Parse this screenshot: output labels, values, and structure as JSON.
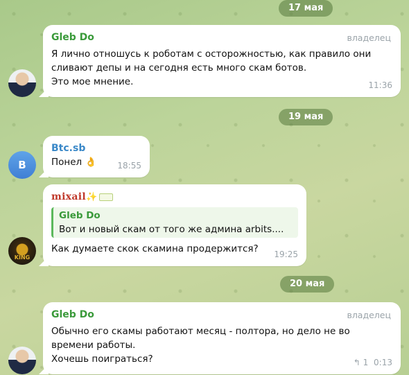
{
  "dates": [
    "17 мая",
    "19 мая",
    "20 мая"
  ],
  "messages": [
    {
      "sender": "Gleb Do",
      "role": "владелец",
      "text": "Я лично отношусь к роботам с осторожностью, как правило они\nсливают депы и на сегодня есть много скам ботов.\nЭто мое мнение.",
      "time": "11:36"
    },
    {
      "sender": "Btc.sb",
      "avatar_letter": "B",
      "text": "Понел 👌",
      "time": "18:55"
    },
    {
      "sender": "mixail",
      "sender_suffix": "✨",
      "avatar_text": "KING",
      "quote_sender": "Gleb Do",
      "quote_text": "Вот и новый скам от того же админа arbits....",
      "text": "Как думаете скок скамина продержится?",
      "time": "19:25"
    },
    {
      "sender": "Gleb Do",
      "role": "владелец",
      "text": "Обычно его скамы работают месяц - полтора, но дело не во\nвремени работы.\nХочешь поиграться?",
      "reply_icon": "↰",
      "reply_count": "1",
      "time": "0:13"
    }
  ]
}
